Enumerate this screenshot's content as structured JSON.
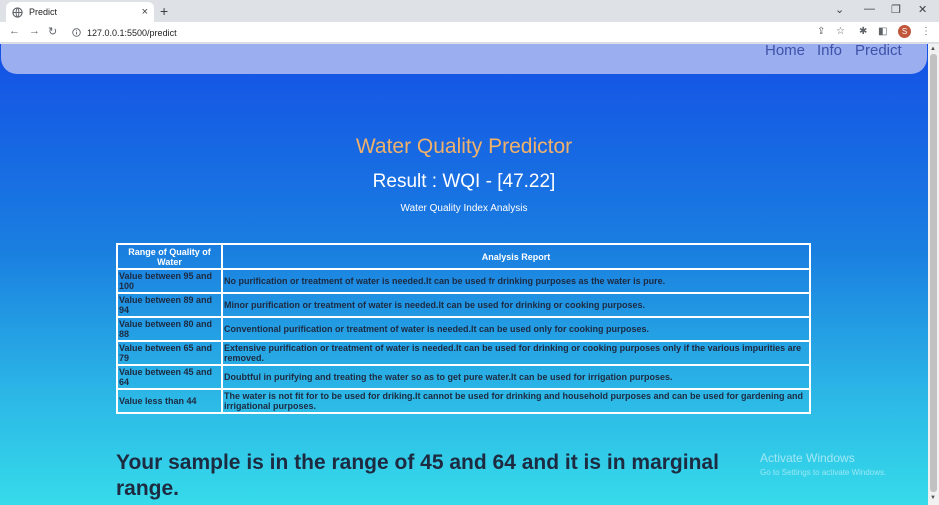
{
  "browser": {
    "tab_title": "Predict",
    "tab_close": "×",
    "new_tab": "+",
    "url": "127.0.0.1:5500/predict",
    "avatar_letter": "S",
    "icons": [
      "globe-icon",
      "close-icon",
      "back-icon",
      "forward-icon",
      "reload-icon",
      "info-icon",
      "share-icon",
      "star-icon",
      "extensions-icon",
      "sidepanel-icon",
      "menu-icon"
    ]
  },
  "nav": {
    "home": "Home",
    "info": "Info",
    "predict": "Predict"
  },
  "page": {
    "title": "Water Quality Predictor",
    "result": "Result : WQI - [47.22]",
    "subtitle": "Water Quality Index Analysis",
    "conclusion": "Your sample is in the range of 45 and 64 and it is in marginal range."
  },
  "table": {
    "headers": [
      "Range of Quality of Water",
      "Analysis Report"
    ],
    "rows": [
      [
        "Value between 95 and 100",
        "No purification or treatment of water is needed.It can be used fr drinking purposes as the water is pure."
      ],
      [
        "Value between 89 and 94",
        "Minor purification or treatment of water is needed.It can be used for drinking or cooking purposes."
      ],
      [
        "Value between 80 and 88",
        "Conventional purification or treatment of water is needed.It can be used only for cooking purposes."
      ],
      [
        "Value between 65 and 79",
        "Extensive purification or treatment of water is needed.It can be used for drinking or cooking purposes only if the various impurities are removed."
      ],
      [
        "Value between 45 and 64",
        "Doubtful in purifying and treating the water so as to get pure water.It can be used for irrigation purposes."
      ],
      [
        "Value less than 44",
        "The water is not fit for to be used for driking.It cannot be used for drinking and household purposes and can be used for gardening and irrigational purposes."
      ]
    ]
  },
  "overlay": {
    "activate_title": "Activate Windows",
    "activate_sub": "Go to Settings to activate Windows."
  }
}
